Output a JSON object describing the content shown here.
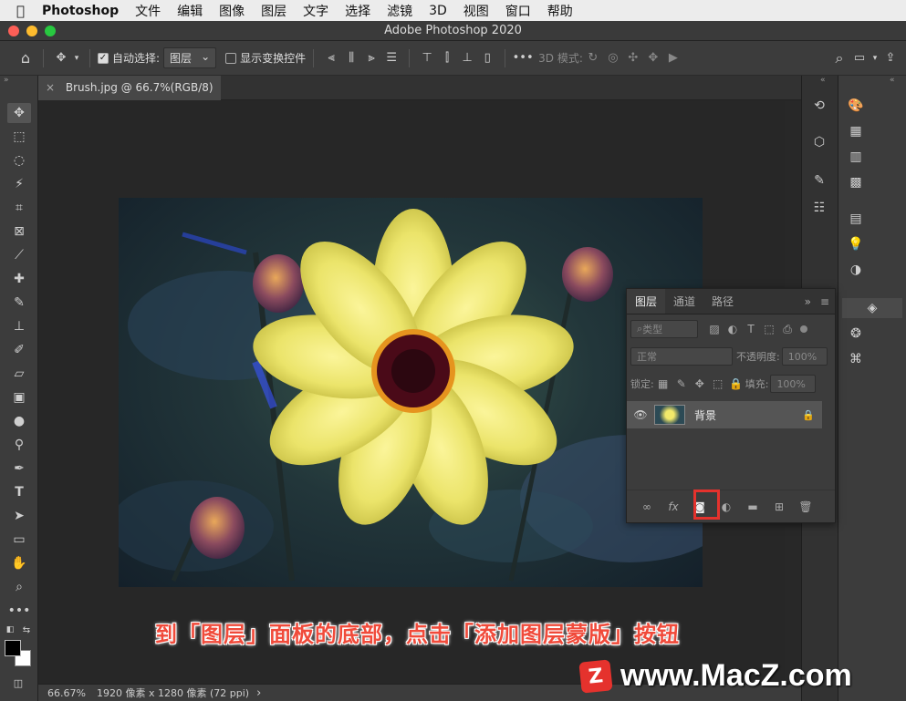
{
  "menubar": {
    "app": "Photoshop",
    "items": [
      "文件",
      "编辑",
      "图像",
      "图层",
      "文字",
      "选择",
      "滤镜",
      "3D",
      "视图",
      "窗口",
      "帮助"
    ]
  },
  "window": {
    "title": "Adobe Photoshop 2020"
  },
  "options": {
    "auto_select": "自动选择:",
    "target": "图层",
    "show_transform": "显示变换控件",
    "mode3d": "3D 模式:"
  },
  "document": {
    "tab": "Brush.jpg @ 66.7%(RGB/8) *",
    "close": "×"
  },
  "status": {
    "zoom": "66.67%",
    "info": "1920 像素 x 1280 像素 (72 ppi)",
    "arrow": "›"
  },
  "layers_panel": {
    "tabs": [
      "图层",
      "通道",
      "路径"
    ],
    "filter": "类型",
    "blend_mode": "正常",
    "opacity_label": "不透明度:",
    "opacity": "100%",
    "lock_label": "锁定:",
    "fill_label": "填充:",
    "fill": "100%",
    "layer_name": "背景",
    "link_label": "∞",
    "fx_label": "fx"
  },
  "caption": "到「图层」面板的底部，点击「添加图层蒙版」按钮",
  "watermark": {
    "logo": "Z",
    "text": "www.MacZ.com"
  },
  "colors": {
    "highlight": "#e5322d",
    "caption": "#f04a3a",
    "bg": "#282828"
  }
}
